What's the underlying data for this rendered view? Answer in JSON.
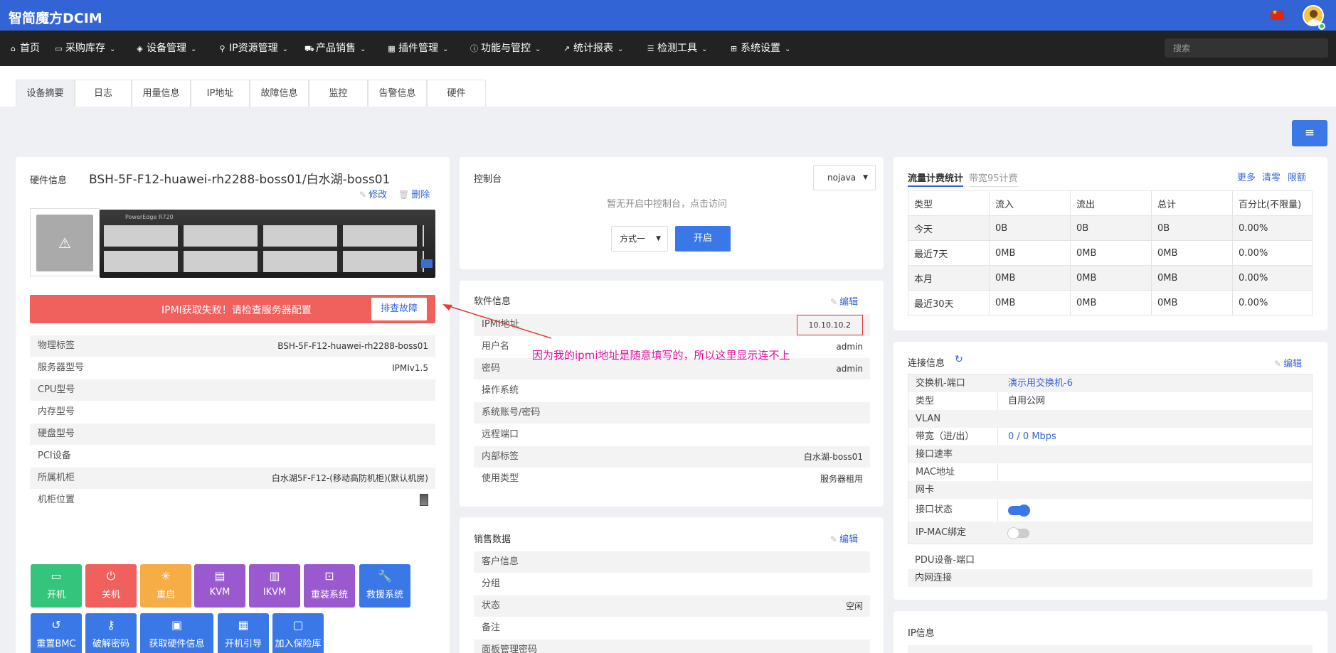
{
  "app": {
    "brand": "智简魔方DCIM",
    "flag_icon": "china-flag-icon",
    "avatar_icon": "user-avatar-icon"
  },
  "nav": {
    "items": [
      {
        "label": "首页",
        "icon": "home-icon",
        "dropdown": false
      },
      {
        "label": "采购库存",
        "icon": "cart-icon",
        "dropdown": true
      },
      {
        "label": "设备管理",
        "icon": "cube-icon",
        "dropdown": true
      },
      {
        "label": "IP资源管理",
        "icon": "map-marker-icon",
        "dropdown": true
      },
      {
        "label": "产品销售",
        "icon": "shopping-cart-icon",
        "dropdown": true
      },
      {
        "label": "插件管理",
        "icon": "grid-icon",
        "dropdown": true
      },
      {
        "label": "功能与管控",
        "icon": "info-circle-icon",
        "dropdown": true
      },
      {
        "label": "统计报表",
        "icon": "line-chart-icon",
        "dropdown": true
      },
      {
        "label": "检测工具",
        "icon": "list-icon",
        "dropdown": true
      },
      {
        "label": "系统设置",
        "icon": "windows-icon",
        "dropdown": true
      }
    ],
    "search_placeholder": "搜索"
  },
  "tabs": [
    "设备摘要",
    "日志",
    "用量信息",
    "IP地址",
    "故障信息",
    "监控",
    "告警信息",
    "硬件"
  ],
  "active_tab": 0,
  "hardware": {
    "title": "硬件信息",
    "device_name": "BSH-5F-F12-huawei-rh2288-boss01/白水湖-boss01",
    "edit_label": "修改",
    "delete_label": "删除",
    "server_badge": "PowerEdge R720",
    "alert_text": "IPMI获取失败！请检查服务器配置",
    "alert_button": "排查故障",
    "rows": [
      {
        "key": "物理标签",
        "value": "BSH-5F-F12-huawei-rh2288-boss01"
      },
      {
        "key": "服务器型号",
        "value": "IPMIv1.5"
      },
      {
        "key": "CPU型号",
        "value": ""
      },
      {
        "key": "内存型号",
        "value": ""
      },
      {
        "key": "硬盘型号",
        "value": ""
      },
      {
        "key": "PCI设备",
        "value": ""
      },
      {
        "key": "所属机柜",
        "value": "白水湖5F-F12-(移动高防机柜)(默认机房)"
      },
      {
        "key": "机柜位置",
        "value": ""
      }
    ],
    "actions": [
      {
        "label": "开机",
        "icon": "monitor-icon",
        "color": "#34c47c"
      },
      {
        "label": "关机",
        "icon": "power-icon",
        "color": "#f0605d"
      },
      {
        "label": "重启",
        "icon": "spinner-icon",
        "color": "#f6ad46"
      },
      {
        "label": "KVM",
        "icon": "kvm-icon",
        "color": "#9b59d0"
      },
      {
        "label": "IKVM",
        "icon": "ikvm-icon",
        "color": "#9b59d0"
      },
      {
        "label": "重装系统",
        "icon": "install-icon",
        "color": "#9b59d0"
      },
      {
        "label": "救援系统",
        "icon": "wrench-icon",
        "color": "#3b78e7"
      },
      {
        "label": "重置BMC",
        "icon": "undo-icon",
        "color": "#3b78e7"
      },
      {
        "label": "破解密码",
        "icon": "key-icon",
        "color": "#3b78e7"
      },
      {
        "label": "获取硬件信息",
        "icon": "document-icon",
        "color": "#3b78e7"
      },
      {
        "label": "开机引导",
        "icon": "boot-icon",
        "color": "#3b78e7"
      },
      {
        "label": "加入保险库",
        "icon": "vault-icon",
        "color": "#3b78e7"
      }
    ]
  },
  "console": {
    "title": "控制台",
    "mode_select": "nojava",
    "hint": "暂无开启中控制台，点击访问",
    "method_select": "方式一",
    "open_button": "开启"
  },
  "software": {
    "title": "软件信息",
    "edit_label": "编辑",
    "rows": [
      {
        "key": "IPMI地址",
        "value": "10.10.10.2"
      },
      {
        "key": "用户名",
        "value": "admin"
      },
      {
        "key": "密码",
        "value": "admin"
      },
      {
        "key": "操作系统",
        "value": ""
      },
      {
        "key": "系统账号/密码",
        "value": ""
      },
      {
        "key": "远程端口",
        "value": ""
      },
      {
        "key": "内部标签",
        "value": "白水湖-boss01"
      },
      {
        "key": "使用类型",
        "value": "服务器租用"
      }
    ]
  },
  "sales": {
    "title": "销售数据",
    "edit_label": "编辑",
    "rows": [
      {
        "key": "客户信息",
        "value": ""
      },
      {
        "key": "分组",
        "value": ""
      },
      {
        "key": "状态",
        "value": "空闲"
      },
      {
        "key": "备注",
        "value": ""
      },
      {
        "key": "面板管理密码",
        "value": ""
      }
    ]
  },
  "annotation": "因为我的ipmi地址是随意填写的，所以这里显示连不上",
  "traffic": {
    "tab_active": "流量计费统计",
    "tab_other": "带宽95计费",
    "links": [
      "更多",
      "清零",
      "限额"
    ],
    "headers": [
      "类型",
      "流入",
      "流出",
      "总计",
      "百分比(不限量)"
    ],
    "rows": [
      [
        "今天",
        "0B",
        "0B",
        "0B",
        "0.00%"
      ],
      [
        "最近7天",
        "0MB",
        "0MB",
        "0MB",
        "0.00%"
      ],
      [
        "本月",
        "0MB",
        "0MB",
        "0MB",
        "0.00%"
      ],
      [
        "最近30天",
        "0MB",
        "0MB",
        "0MB",
        "0.00%"
      ]
    ]
  },
  "connection": {
    "title": "连接信息",
    "edit_label": "编辑",
    "rows": [
      {
        "key": "交换机-端口",
        "value": "演示用交换机-6"
      },
      {
        "key": "类型",
        "value": "自用公网"
      },
      {
        "key": "VLAN",
        "value": ""
      },
      {
        "key": "带宽（进/出）",
        "value": "0 / 0 Mbps"
      },
      {
        "key": "接口速率",
        "value": ""
      },
      {
        "key": "MAC地址",
        "value": ""
      },
      {
        "key": "网卡",
        "value": ""
      },
      {
        "key": "接口状态",
        "value": ""
      },
      {
        "key": "IP-MAC绑定",
        "value": ""
      }
    ],
    "interface_status_on": true,
    "ip_mac_bind_on": false,
    "extra_rows": [
      "PDU设备-端口",
      "内网连接"
    ]
  },
  "ip_info": {
    "title": "IP信息"
  },
  "colors": {
    "topbar": "#3364d6",
    "navbar": "#222222",
    "link": "#3364d6",
    "alert": "#f0605d",
    "primary": "#3b78e7"
  }
}
